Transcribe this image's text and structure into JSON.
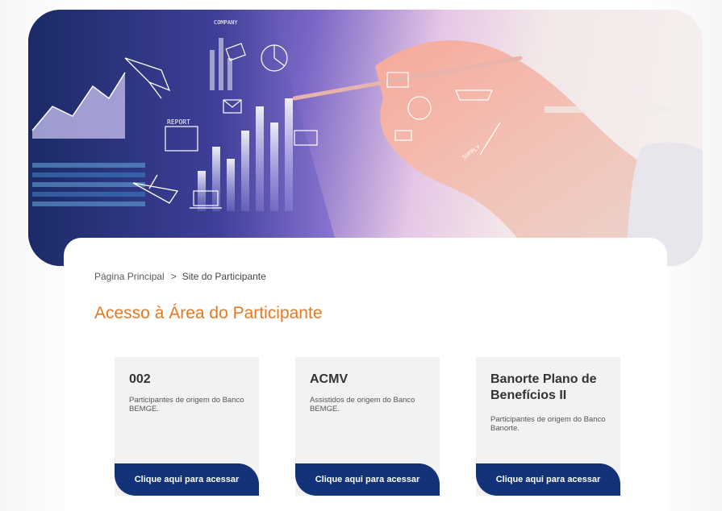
{
  "breadcrumb": {
    "home": "Página Principal",
    "separator": ">",
    "current": "Site do Participante"
  },
  "page_title": "Acesso à Área do Participante",
  "hero": {
    "report_label": "REPORT",
    "company_label": "COMPANY",
    "supply_label": "SUPPLY"
  },
  "plans": [
    {
      "name": "002",
      "description": "Participantes de origem do Banco BEMGE.",
      "button_label": "Clique aqui para acessar"
    },
    {
      "name": "ACMV",
      "description": "Assistidos de origem do Banco BEMGE.",
      "button_label": "Clique aqui para acessar"
    },
    {
      "name": "Banorte Plano de Benefícios II",
      "description": "Participantes de origem do Banco Banorte.",
      "button_label": "Clique aqui para acessar"
    }
  ],
  "colors": {
    "accent_orange": "#e8781f",
    "button_navy": "#12337a",
    "card_gray": "#f2f2f2"
  }
}
